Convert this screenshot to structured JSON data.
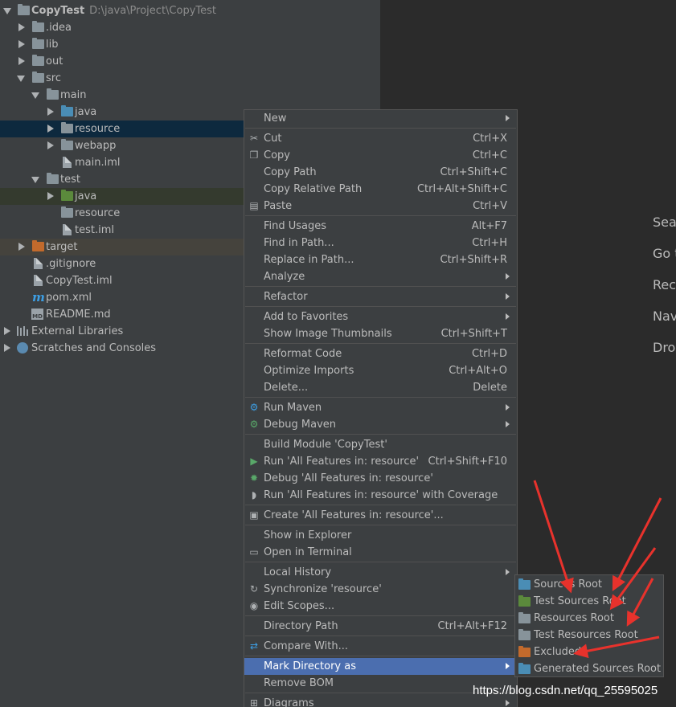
{
  "tree": {
    "project_name": "CopyTest",
    "project_path": "D:\\java\\Project\\CopyTest",
    "items": [
      {
        "label": ".idea"
      },
      {
        "label": "lib"
      },
      {
        "label": "out"
      },
      {
        "label": "src"
      },
      {
        "label": "main"
      },
      {
        "label": "java"
      },
      {
        "label": "resource"
      },
      {
        "label": "webapp"
      },
      {
        "label": "main.iml"
      },
      {
        "label": "test"
      },
      {
        "label": "java"
      },
      {
        "label": "resource"
      },
      {
        "label": "test.iml"
      },
      {
        "label": "target"
      },
      {
        "label": ".gitignore"
      },
      {
        "label": "CopyTest.iml"
      },
      {
        "label": "pom.xml"
      },
      {
        "label": "README.md"
      },
      {
        "label": "External Libraries"
      },
      {
        "label": "Scratches and Consoles"
      }
    ]
  },
  "menu": {
    "items": [
      {
        "label": "New",
        "shortcut": ""
      },
      {
        "label": "Cut",
        "shortcut": "Ctrl+X"
      },
      {
        "label": "Copy",
        "shortcut": "Ctrl+C"
      },
      {
        "label": "Copy Path",
        "shortcut": "Ctrl+Shift+C"
      },
      {
        "label": "Copy Relative Path",
        "shortcut": "Ctrl+Alt+Shift+C"
      },
      {
        "label": "Paste",
        "shortcut": "Ctrl+V"
      },
      {
        "label": "Find Usages",
        "shortcut": "Alt+F7"
      },
      {
        "label": "Find in Path...",
        "shortcut": "Ctrl+H"
      },
      {
        "label": "Replace in Path...",
        "shortcut": "Ctrl+Shift+R"
      },
      {
        "label": "Analyze",
        "shortcut": ""
      },
      {
        "label": "Refactor",
        "shortcut": ""
      },
      {
        "label": "Add to Favorites",
        "shortcut": ""
      },
      {
        "label": "Show Image Thumbnails",
        "shortcut": "Ctrl+Shift+T"
      },
      {
        "label": "Reformat Code",
        "shortcut": "Ctrl+D"
      },
      {
        "label": "Optimize Imports",
        "shortcut": "Ctrl+Alt+O"
      },
      {
        "label": "Delete...",
        "shortcut": "Delete"
      },
      {
        "label": "Run Maven",
        "shortcut": ""
      },
      {
        "label": "Debug Maven",
        "shortcut": ""
      },
      {
        "label": "Build Module 'CopyTest'",
        "shortcut": ""
      },
      {
        "label": "Run 'All Features in: resource'",
        "shortcut": "Ctrl+Shift+F10"
      },
      {
        "label": "Debug 'All Features in: resource'",
        "shortcut": ""
      },
      {
        "label": "Run 'All Features in: resource' with Coverage",
        "shortcut": ""
      },
      {
        "label": "Create 'All Features in: resource'...",
        "shortcut": ""
      },
      {
        "label": "Show in Explorer",
        "shortcut": ""
      },
      {
        "label": "Open in Terminal",
        "shortcut": ""
      },
      {
        "label": "Local History",
        "shortcut": ""
      },
      {
        "label": "Synchronize 'resource'",
        "shortcut": ""
      },
      {
        "label": "Edit Scopes...",
        "shortcut": ""
      },
      {
        "label": "Directory Path",
        "shortcut": "Ctrl+Alt+F12"
      },
      {
        "label": "Compare With...",
        "shortcut": ""
      },
      {
        "label": "Mark Directory as",
        "shortcut": ""
      },
      {
        "label": "Remove BOM",
        "shortcut": ""
      },
      {
        "label": "Diagrams",
        "shortcut": ""
      }
    ]
  },
  "submenu": {
    "items": [
      {
        "label": "Sources Root",
        "icon": "sources-root-folder-icon",
        "color": "#4a8db5"
      },
      {
        "label": "Test Sources Root",
        "icon": "test-sources-root-folder-icon",
        "color": "#5b8a3c"
      },
      {
        "label": "Resources Root",
        "icon": "resources-root-folder-icon",
        "color": "#87939a"
      },
      {
        "label": "Test Resources Root",
        "icon": "test-resources-root-folder-icon",
        "color": "#87939a"
      },
      {
        "label": "Excluded",
        "icon": "excluded-folder-icon",
        "color": "#c26a2c"
      },
      {
        "label": "Generated Sources Root",
        "icon": "generated-sources-root-folder-icon",
        "color": "#4a8db5"
      }
    ]
  },
  "welcome": {
    "items": [
      "Search Everywhere",
      "Go to File",
      "Recent Files",
      "Navigation Bar",
      "Drop files here to open"
    ]
  },
  "watermark": "https://blog.csdn.net/qq_25595025",
  "colors": {
    "tree_bg": "#3c3f41",
    "editor_bg": "#2b2b2b",
    "highlight": "#4b6eaf",
    "annotation_arrow": "#e8322c"
  }
}
